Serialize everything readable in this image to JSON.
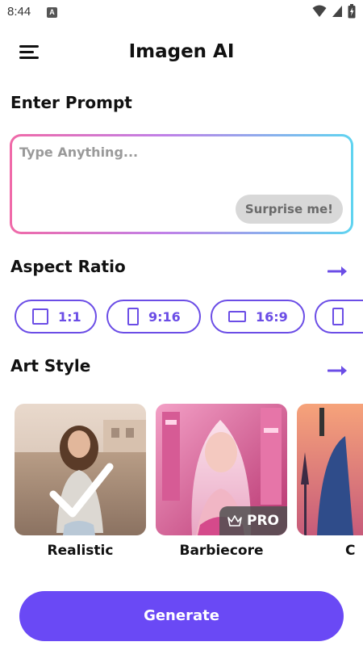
{
  "status_bar": {
    "time": "8:44",
    "notification_letter": "A"
  },
  "app_bar": {
    "title": "Imagen AI"
  },
  "prompt": {
    "heading": "Enter Prompt",
    "placeholder": "Type Anything...",
    "value": "",
    "surprise_label": "Surprise me!"
  },
  "aspect_ratio": {
    "heading": "Aspect Ratio",
    "options": [
      {
        "label": "1:1",
        "icon": "square-icon"
      },
      {
        "label": "9:16",
        "icon": "portrait-rect-icon"
      },
      {
        "label": "16:9",
        "icon": "landscape-rect-icon"
      },
      {
        "label": "",
        "icon": "portrait-rect-icon"
      }
    ]
  },
  "art_style": {
    "heading": "Art Style",
    "styles": [
      {
        "label": "Realistic",
        "selected": true
      },
      {
        "label": "Barbiecore",
        "badge": "PRO"
      },
      {
        "label": "C"
      }
    ]
  },
  "generate": {
    "label": "Generate"
  },
  "colors": {
    "accent": "#6a49f5",
    "chip_border": "#6b4de6",
    "gradient_start": "#f06aa8",
    "gradient_end": "#5fd4f0"
  }
}
